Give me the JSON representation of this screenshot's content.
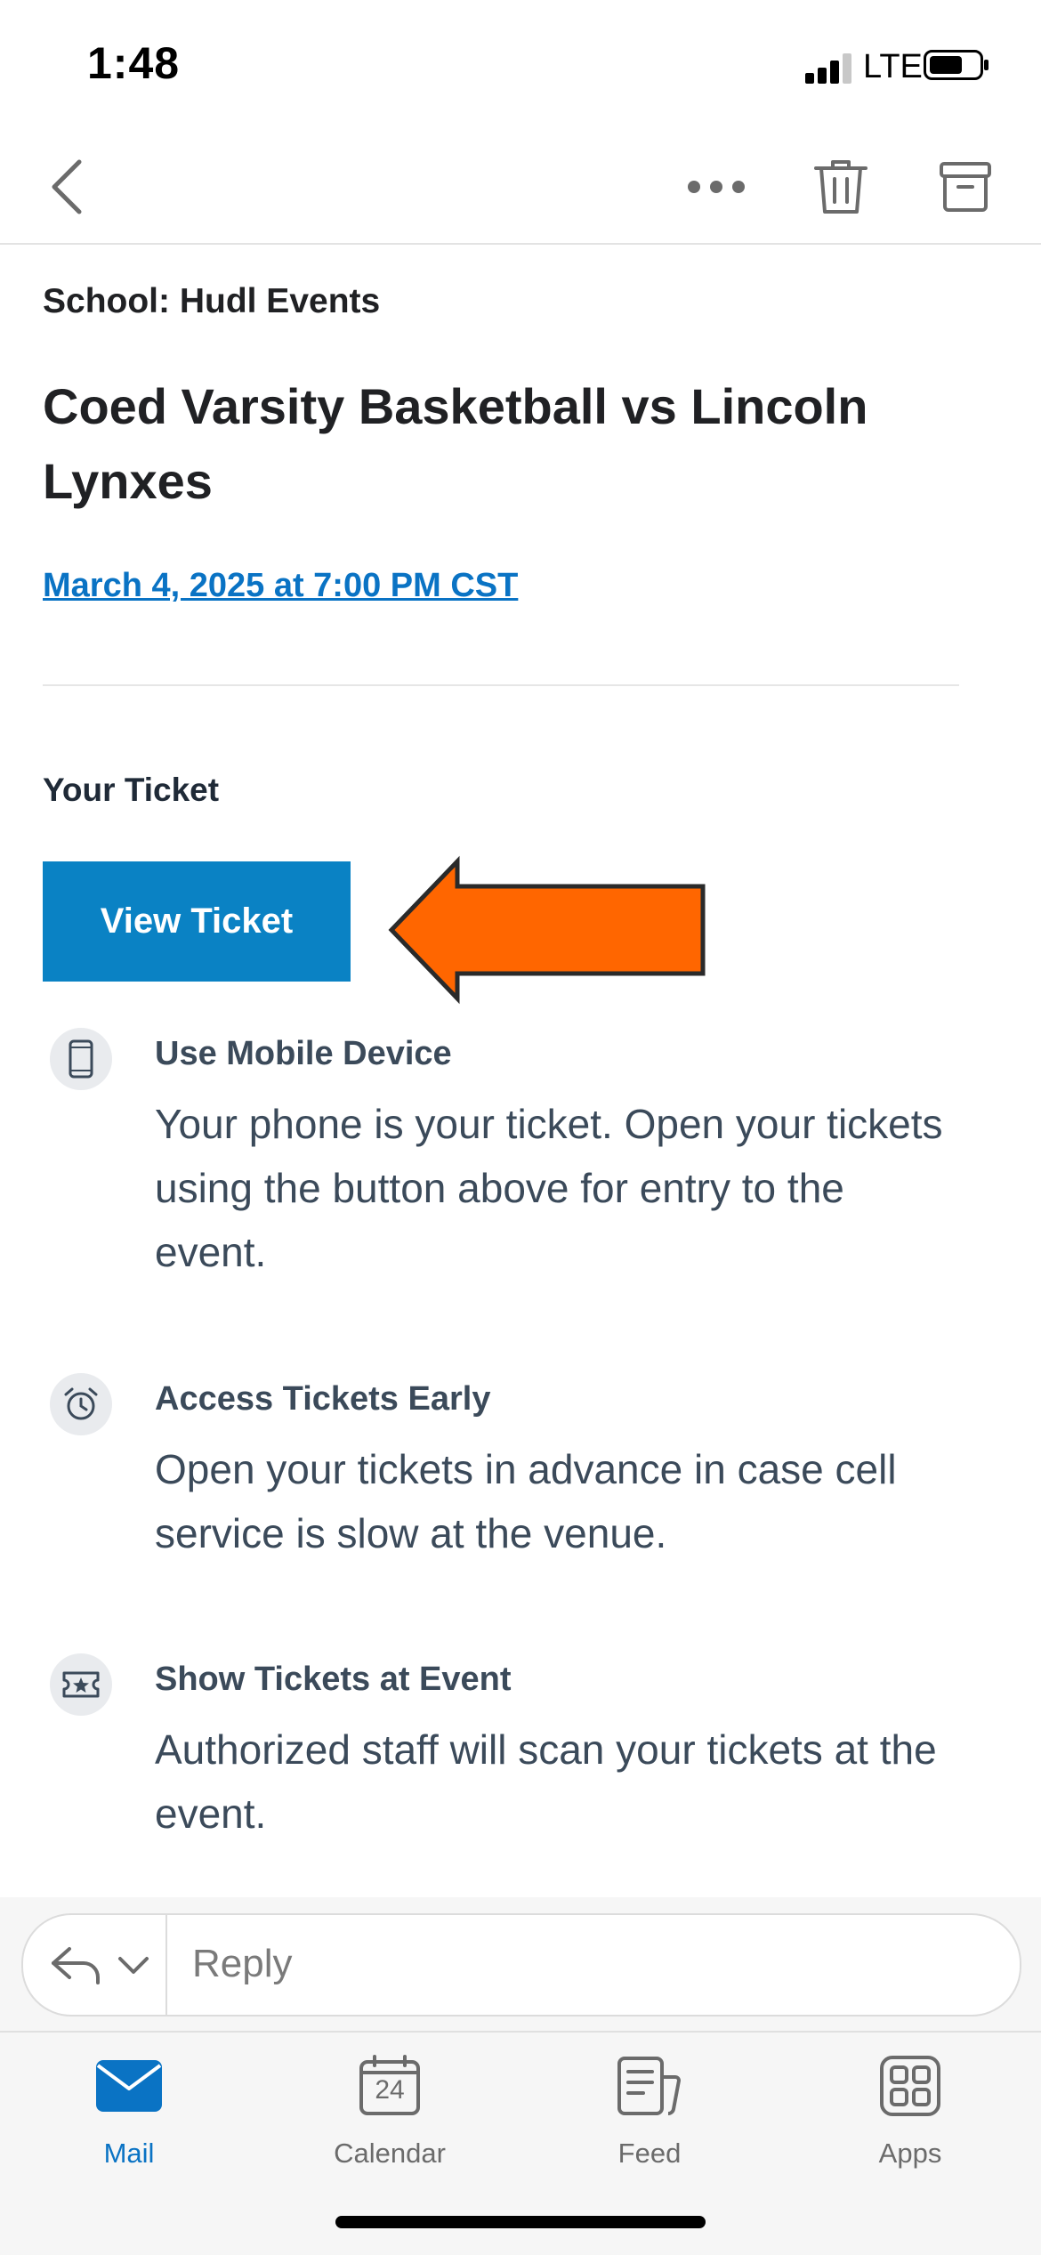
{
  "status_bar": {
    "time": "1:48",
    "network": "LTE"
  },
  "nav": {
    "back_icon": "chevron-left-icon",
    "more_icon": "more-dots-icon",
    "delete_icon": "trash-icon",
    "archive_icon": "archive-icon"
  },
  "email": {
    "school": "School: Hudl Events",
    "title": "Coed Varsity Basketball vs Lincoln Lynxes",
    "date": "March 4, 2025 at 7:00 PM CST",
    "your_ticket": "Your Ticket",
    "view_ticket_button": "View Ticket",
    "info": [
      {
        "icon": "mobile-device-icon",
        "heading": "Use Mobile Device",
        "body": "Your phone is your ticket. Open your tickets using the button above for entry to the event."
      },
      {
        "icon": "alarm-clock-icon",
        "heading": "Access Tickets Early",
        "body": "Open your tickets in advance in case cell service is slow at the venue."
      },
      {
        "icon": "ticket-star-icon",
        "heading": "Show Tickets at Event",
        "body": "Authorized staff will scan your tickets at the event."
      }
    ]
  },
  "reply": {
    "placeholder": "Reply"
  },
  "tabs": [
    {
      "label": "Mail",
      "icon": "mail-icon",
      "active": true
    },
    {
      "label": "Calendar",
      "icon": "calendar-icon",
      "day": "24",
      "active": false
    },
    {
      "label": "Feed",
      "icon": "feed-icon",
      "active": false
    },
    {
      "label": "Apps",
      "icon": "apps-grid-icon",
      "active": false
    }
  ],
  "colors": {
    "accent": "#0a73c4",
    "button": "#0a82c4",
    "arrow": "#ff6600",
    "text": "#3b4a5a"
  }
}
